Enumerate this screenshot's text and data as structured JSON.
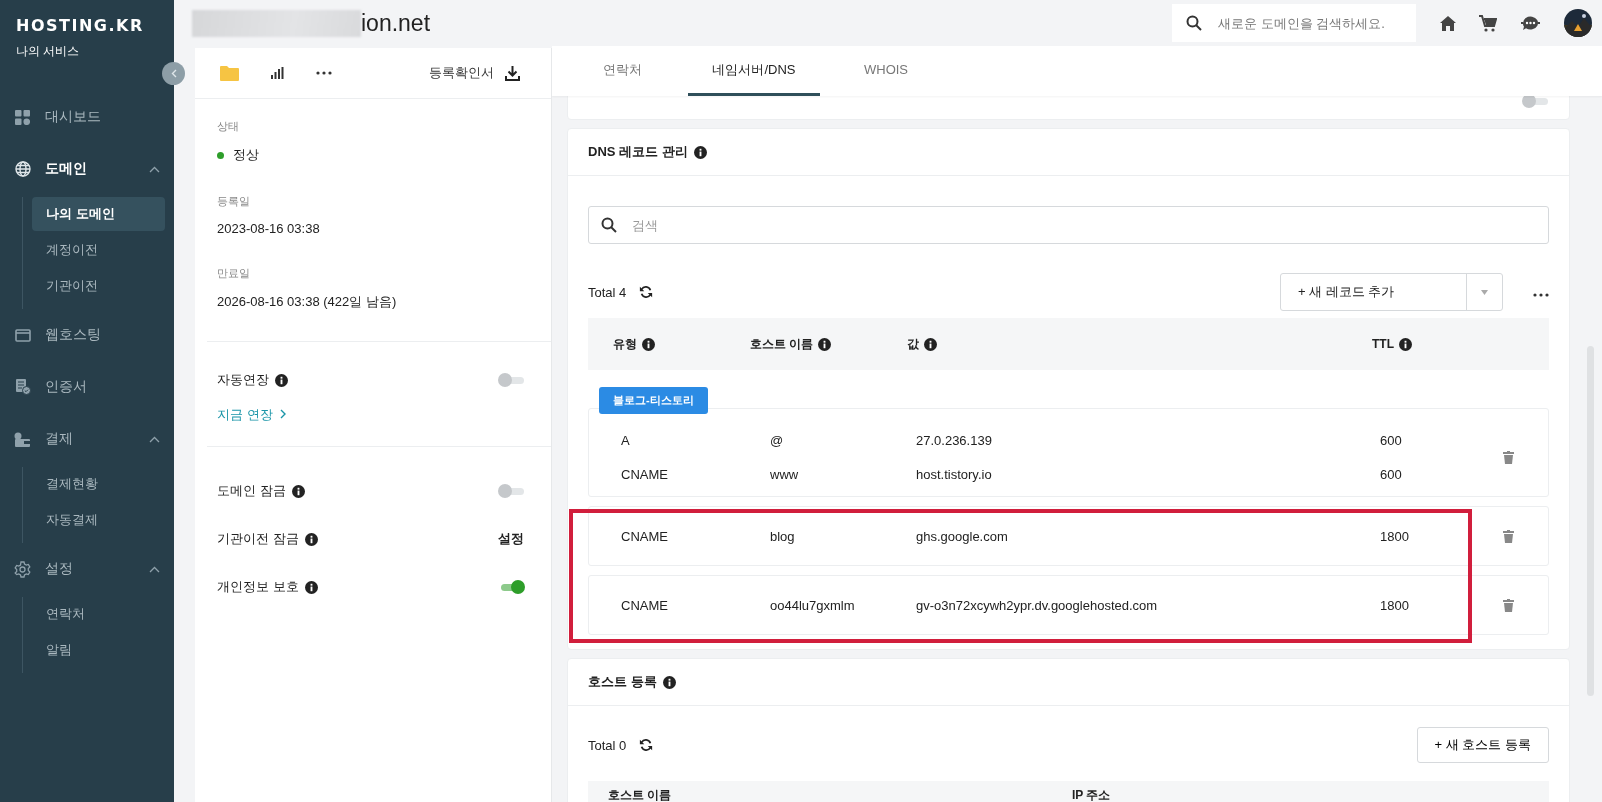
{
  "sidebar": {
    "logo": "HOSTING.KR",
    "subtitle": "나의 서비스",
    "items": [
      {
        "label": "대시보드",
        "selected": false
      },
      {
        "label": "도메인",
        "selected": true,
        "expanded": true,
        "children": [
          {
            "label": "나의 도메인",
            "selected": true
          },
          {
            "label": "계정이전",
            "selected": false
          },
          {
            "label": "기관이전",
            "selected": false
          }
        ]
      },
      {
        "label": "웹호스팅",
        "selected": false
      },
      {
        "label": "인증서",
        "selected": false
      },
      {
        "label": "결제",
        "selected": false,
        "expanded": true,
        "children": [
          {
            "label": "결제현황",
            "selected": false
          },
          {
            "label": "자동결제",
            "selected": false
          }
        ]
      },
      {
        "label": "설정",
        "selected": false,
        "expanded": true,
        "children": [
          {
            "label": "연락처",
            "selected": false
          },
          {
            "label": "알림",
            "selected": false
          }
        ]
      }
    ]
  },
  "header": {
    "title": "ion.net",
    "search": {
      "placeholder": "새로운 도메인을 검색하세요."
    }
  },
  "domain_panel": {
    "certificate_button": "등록확인서",
    "fields": [
      {
        "label": "상태",
        "value": "정상"
      },
      {
        "label": "등록일",
        "value": "2023-08-16 03:38"
      },
      {
        "label": "만료일",
        "value": "2026-08-16 03:38 (422일 남음)"
      }
    ],
    "renewal": {
      "label": "자동연장",
      "on": false,
      "link": "지금 연장"
    },
    "settings": [
      {
        "kind": "toggle",
        "label": "도메인 잠금",
        "on": false
      },
      {
        "kind": "action",
        "label": "기관이전 잠금",
        "action": "설정"
      },
      {
        "kind": "toggle",
        "label": "개인정보 보호",
        "on": true
      }
    ]
  },
  "tabs": [
    {
      "label": "연락처",
      "selected": false
    },
    {
      "label": "네임서버/DNS",
      "selected": true
    },
    {
      "label": "WHOIS",
      "selected": false
    }
  ],
  "forwarding": {
    "on": false
  },
  "dns_records": {
    "title": "DNS 레코드 관리",
    "search": {
      "placeholder": "검색"
    },
    "total": "Total 4",
    "add_button": "+ 새 레코드 추가",
    "columns": [
      "유형",
      "호스트 이름",
      "값",
      "TTL"
    ],
    "groups": [
      {
        "tag": "블로그-티스토리",
        "highlighted": false,
        "records": [
          {
            "type": "A",
            "host": "@",
            "value": "27.0.236.139",
            "ttl": "600"
          },
          {
            "type": "CNAME",
            "host": "www",
            "value": "host.tistory.io",
            "ttl": "600"
          }
        ]
      },
      {
        "highlighted": true,
        "records": [
          {
            "type": "CNAME",
            "host": "blog",
            "value": "ghs.google.com",
            "ttl": "1800"
          }
        ]
      },
      {
        "highlighted": true,
        "records": [
          {
            "type": "CNAME",
            "host": "oo44lu7gxmlm",
            "value": "gv-o3n72xcywh2ypr.dv.googlehosted.com",
            "ttl": "1800"
          }
        ]
      }
    ]
  },
  "host_registration": {
    "title": "호스트 등록",
    "total": "Total 0",
    "add_button": "+ 새 호스트 등록",
    "columns": [
      "호스트 이름",
      "IP 주소"
    ]
  }
}
